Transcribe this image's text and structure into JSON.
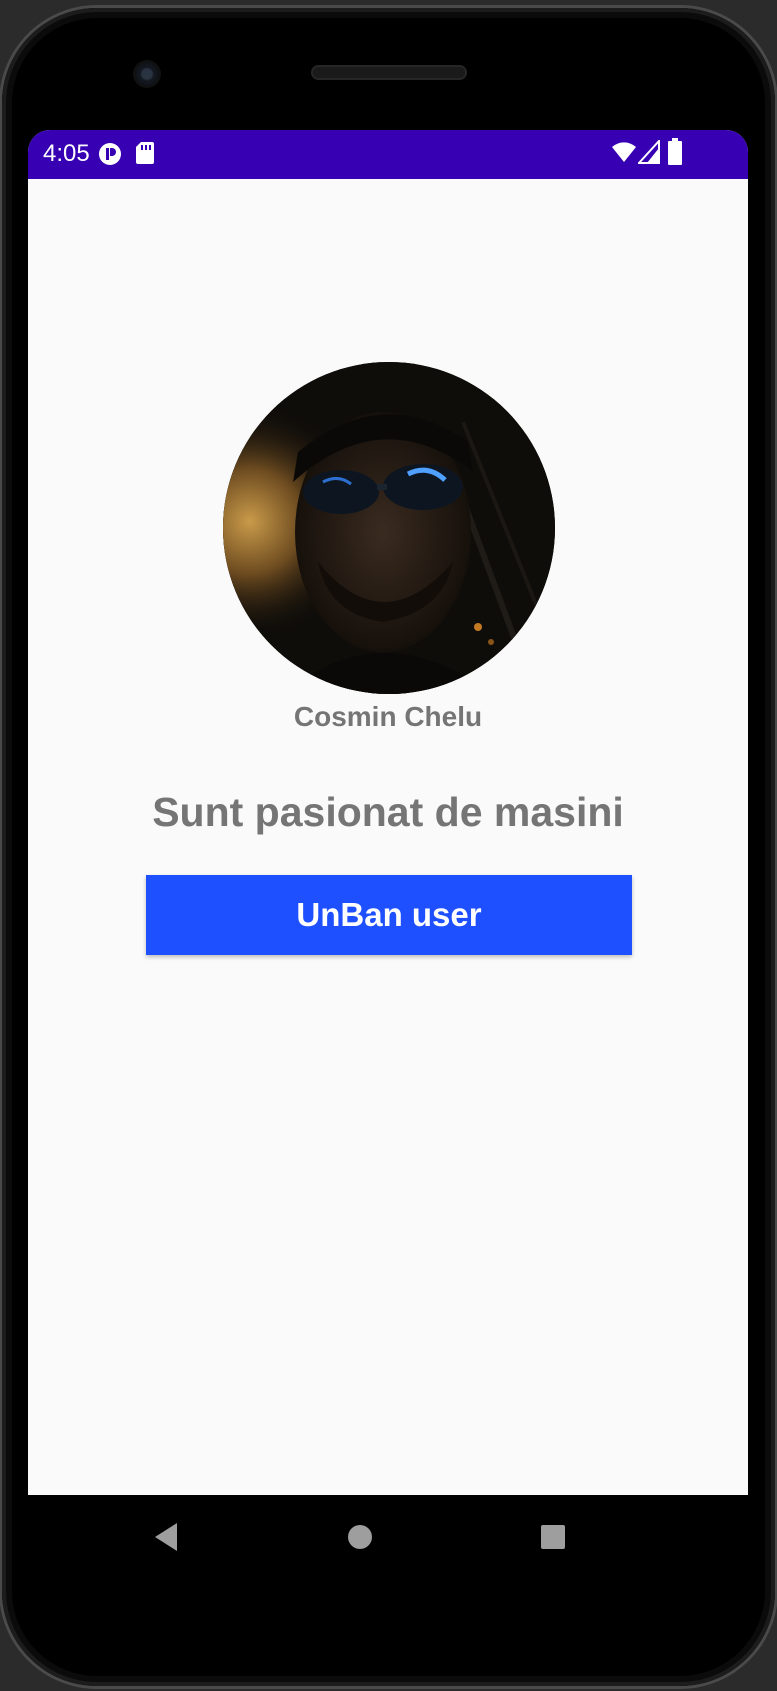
{
  "status_bar": {
    "time": "4:05",
    "icons": [
      "play-protect-icon",
      "sd-card-icon",
      "wifi-icon",
      "signal-icon",
      "battery-icon"
    ],
    "background_color": "#3700b3"
  },
  "profile": {
    "avatar_icon": "profile-photo",
    "name": "Cosmin Chelu",
    "bio": "Sunt pasionat de masini"
  },
  "actions": {
    "unban_label": "UnBan user",
    "unban_color": "#1e50ff"
  },
  "nav_bar": {
    "icons": [
      "back-icon",
      "home-icon",
      "recents-icon"
    ]
  }
}
